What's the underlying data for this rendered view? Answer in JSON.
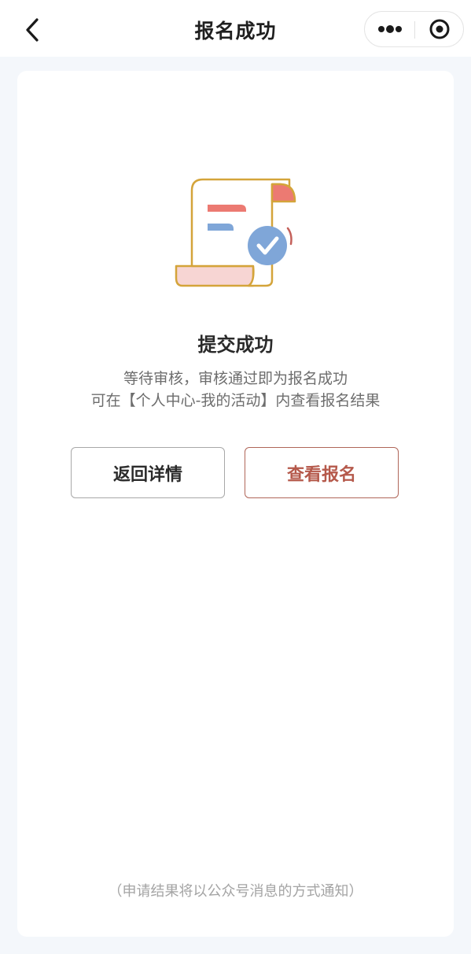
{
  "nav": {
    "title": "报名成功",
    "back_icon": "chevron-left-icon",
    "more_icon": "more-dots-icon",
    "close_icon": "target-circle-icon"
  },
  "illustration": {
    "icon": "document-check-icon",
    "colors": {
      "outline": "#d4a43a",
      "red": "#ec7a72",
      "blue": "#7fa6d8",
      "pink": "#f7d5d3"
    }
  },
  "result": {
    "title": "提交成功",
    "line1": "等待审核，审核通过即为报名成功",
    "line2": "可在【个人中心-我的活动】内查看报名结果"
  },
  "buttons": {
    "back_label": "返回详情",
    "view_label": "查看报名"
  },
  "footnote": "（申请结果将以公众号消息的方式通知）",
  "colors": {
    "accent": "#b5594b",
    "page_bg": "#f4f7fb"
  }
}
